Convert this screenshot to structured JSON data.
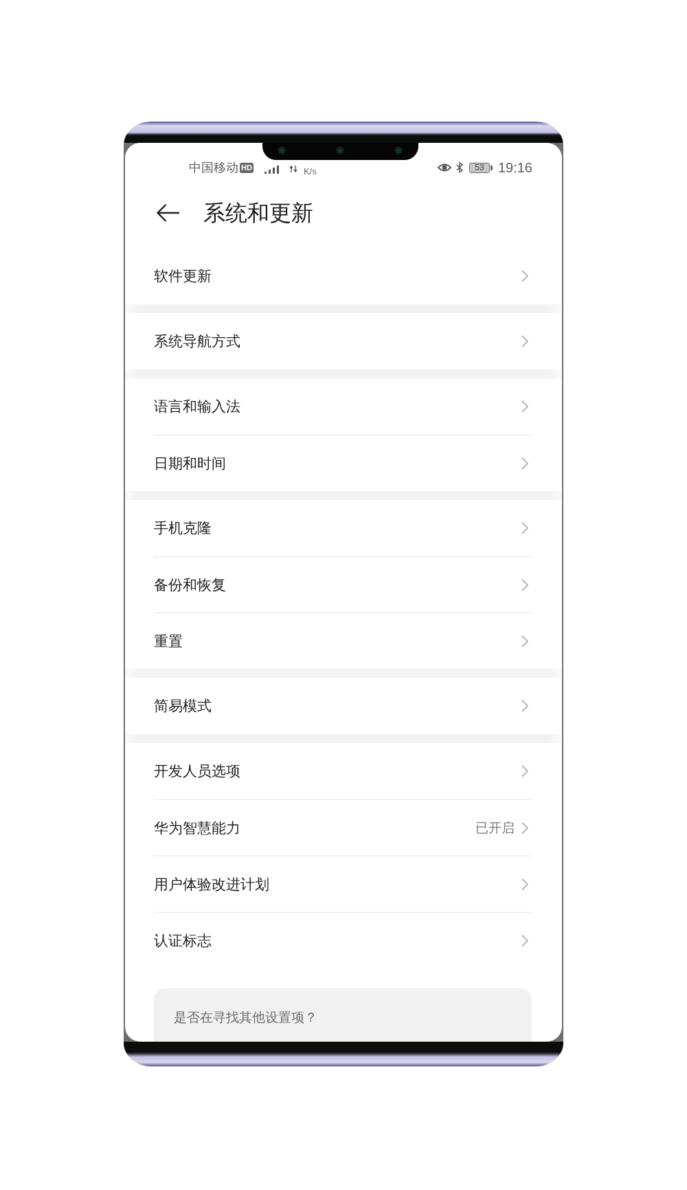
{
  "status_bar": {
    "carrier": "中国移动",
    "hd_badge": "HD",
    "speed_unit": "K/s",
    "battery": "53",
    "time": "19:16"
  },
  "header": {
    "title": "系统和更新"
  },
  "groups": [
    {
      "items": [
        {
          "label": "软件更新"
        }
      ]
    },
    {
      "items": [
        {
          "label": "系统导航方式"
        }
      ]
    },
    {
      "items": [
        {
          "label": "语言和输入法"
        },
        {
          "label": "日期和时间"
        }
      ]
    },
    {
      "items": [
        {
          "label": "手机克隆"
        },
        {
          "label": "备份和恢复"
        },
        {
          "label": "重置"
        }
      ]
    },
    {
      "items": [
        {
          "label": "简易模式"
        }
      ]
    },
    {
      "items": [
        {
          "label": "开发人员选项"
        },
        {
          "label": "华为智慧能力",
          "value": "已开启"
        },
        {
          "label": "用户体验改进计划"
        },
        {
          "label": "认证标志"
        }
      ]
    }
  ],
  "suggestion_card": {
    "text": "是否在寻找其他设置项？"
  }
}
